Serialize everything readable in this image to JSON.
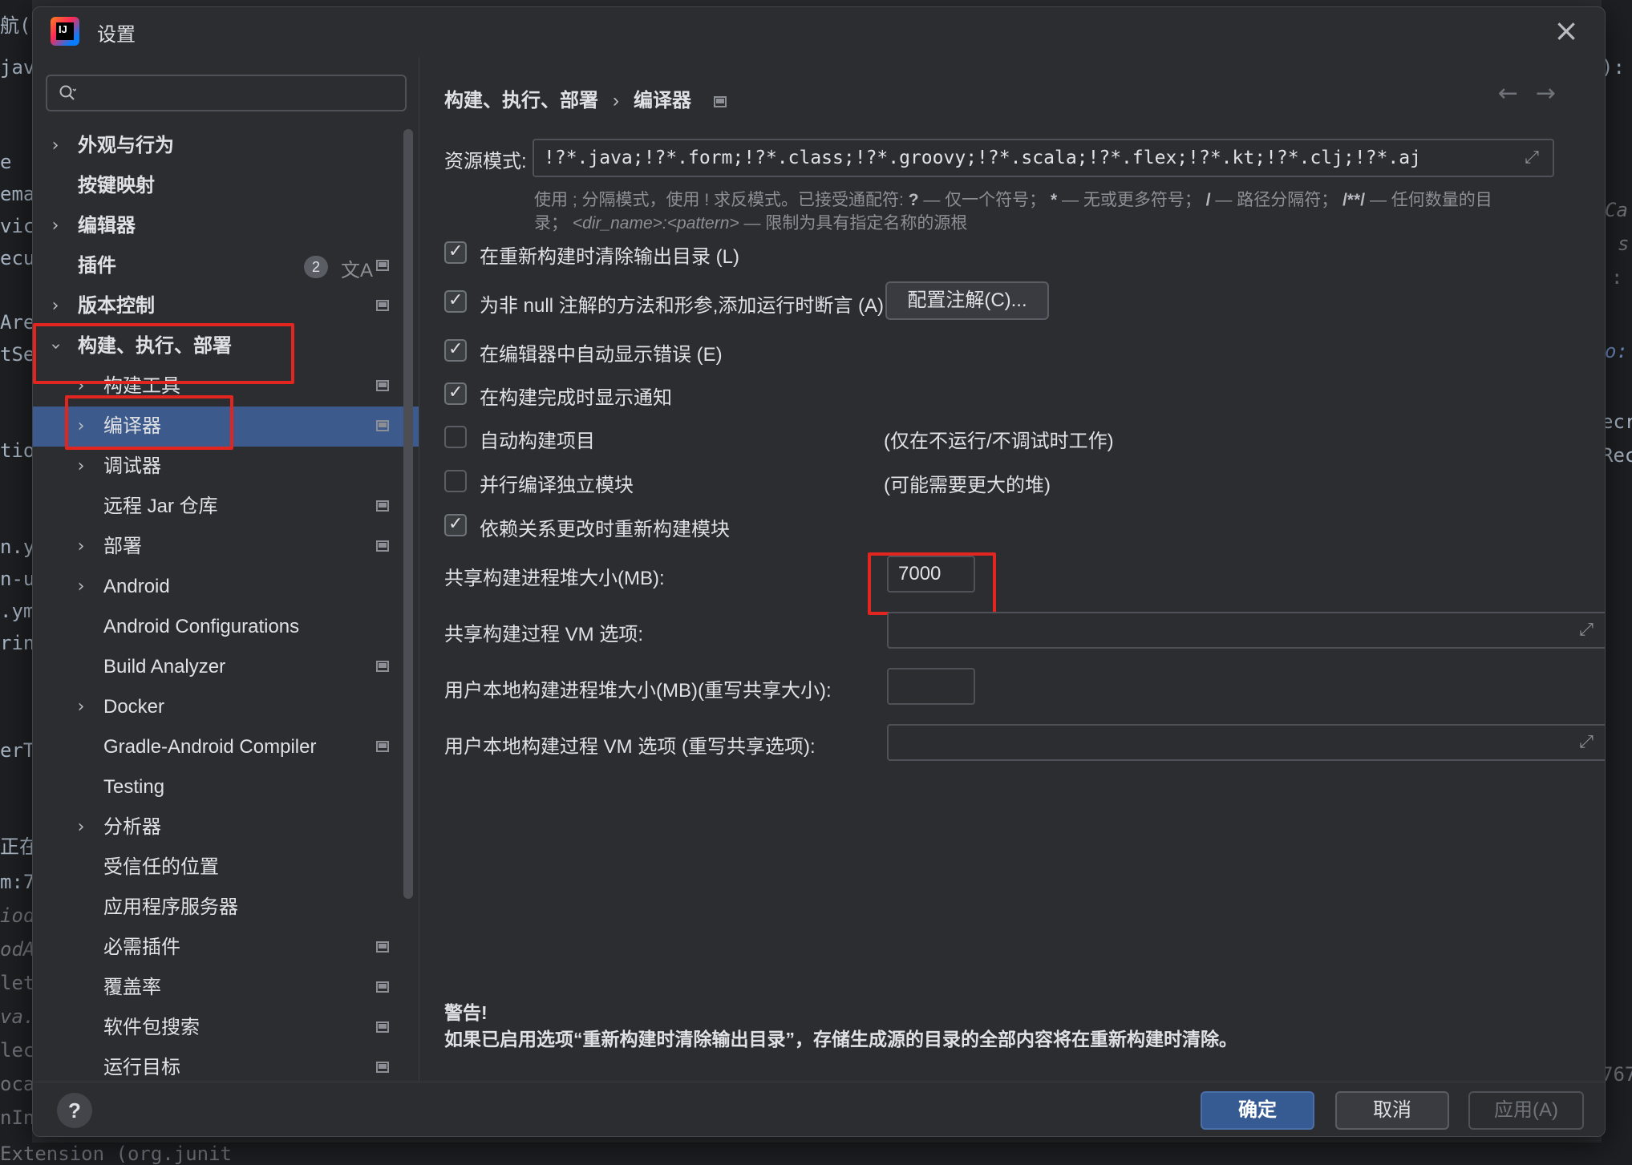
{
  "dialog": {
    "title": "设置",
    "app_logo_text": "IJ",
    "search": {
      "placeholder": "",
      "value": ""
    }
  },
  "sidebar": {
    "items": [
      {
        "label": "外观与行为",
        "bold": true
      },
      {
        "label": "按键映射",
        "bold": true
      },
      {
        "label": "编辑器",
        "bold": true
      },
      {
        "label": "插件",
        "bold": true,
        "badge": "2"
      },
      {
        "label": "版本控制",
        "bold": true
      },
      {
        "label": "构建、执行、部署",
        "bold": true,
        "expanded": true
      },
      {
        "label": "构建工具"
      },
      {
        "label": "编译器",
        "selected": true
      },
      {
        "label": "调试器"
      },
      {
        "label": "远程 Jar 仓库"
      },
      {
        "label": "部署"
      },
      {
        "label": "Android"
      },
      {
        "label": "Android Configurations"
      },
      {
        "label": "Build Analyzer"
      },
      {
        "label": "Docker"
      },
      {
        "label": "Gradle-Android Compiler"
      },
      {
        "label": "Testing"
      },
      {
        "label": "分析器"
      },
      {
        "label": "受信任的位置"
      },
      {
        "label": "应用程序服务器"
      },
      {
        "label": "必需插件"
      },
      {
        "label": "覆盖率"
      },
      {
        "label": "软件包搜索"
      },
      {
        "label": "运行目标"
      }
    ]
  },
  "breadcrumb": {
    "parent": "构建、执行、部署",
    "separator": "›",
    "current": "编译器"
  },
  "nav": {
    "back": "←",
    "forward": "→"
  },
  "compiler": {
    "resource_label": "资源模式:",
    "resource_value": "!?*.java;!?*.form;!?*.class;!?*.groovy;!?*.scala;!?*.flex;!?*.kt;!?*.clj;!?*.aj",
    "hint_line1_a": "使用 ; 分隔模式，使用 ! 求反模式。已接受通配符: ",
    "hint_q": "?",
    "hint_line1_b": " — 仅一个符号； ",
    "hint_star": "*",
    "hint_line1_c": " — 无或更多符号； ",
    "hint_slash": "/",
    "hint_line1_d": " — 路径分隔符； ",
    "hint_dstar": "/**/",
    "hint_line1_e": " — 任何数量的目",
    "hint_line2_a": "录； ",
    "hint_dir": "<dir_name>:<pattern>",
    "hint_line2_b": " — 限制为具有指定名称的源根",
    "options": [
      {
        "label": "在重新构建时清除输出目录 (L)",
        "checked": true
      },
      {
        "label": "为非 null 注解的方法和形参,添加运行时断言 (A)",
        "checked": true
      },
      {
        "label": "在编辑器中自动显示错误 (E)",
        "checked": true
      },
      {
        "label": "在构建完成时显示通知",
        "checked": true
      },
      {
        "label": "自动构建项目",
        "checked": false,
        "note": "(仅在不运行/不调试时工作)"
      },
      {
        "label": "并行编译独立模块",
        "checked": false,
        "note": "(可能需要更大的堆)"
      },
      {
        "label": "依赖关系更改时重新构建模块",
        "checked": true
      }
    ],
    "configure_annotations_button": "配置注解(C)...",
    "shared_heap_label": "共享构建进程堆大小(MB):",
    "shared_heap_value": "7000",
    "shared_vm_label": "共享构建过程 VM 选项:",
    "shared_vm_value": "",
    "user_heap_label": "用户本地构建进程堆大小(MB)(重写共享大小):",
    "user_heap_value": "",
    "user_vm_label": "用户本地构建过程 VM 选项 (重写共享选项):",
    "user_vm_value": "",
    "warning_title": "警告!",
    "warning_body": "如果已启用选项“重新构建时清除输出目录”，存储生成源的目录的全部内容将在重新构建时清除。"
  },
  "footer": {
    "help": "?",
    "ok": "确定",
    "cancel": "取消",
    "apply": "应用(A)"
  },
  "background_fragments": {
    "left": [
      "航(",
      "java",
      "e",
      "ema",
      "vice",
      "ecu",
      "Are",
      "tSe",
      "tion",
      "n.y",
      "n-u",
      ".ym",
      "ring",
      "erTe",
      "正在",
      "m:7",
      "iodA",
      "odA",
      "leth",
      "va.l",
      "lect",
      "ocal",
      "nInt",
      "Extension (org.junit"
    ],
    "right": [
      "):",
      "Ca",
      "s",
      ":",
      "o:",
      "ecr",
      "Rec",
      "767"
    ]
  },
  "colors": {
    "accent": "#365b93",
    "selection": "#2e436e",
    "highlight_box": "#e3251f",
    "background": "#2b2d30"
  }
}
